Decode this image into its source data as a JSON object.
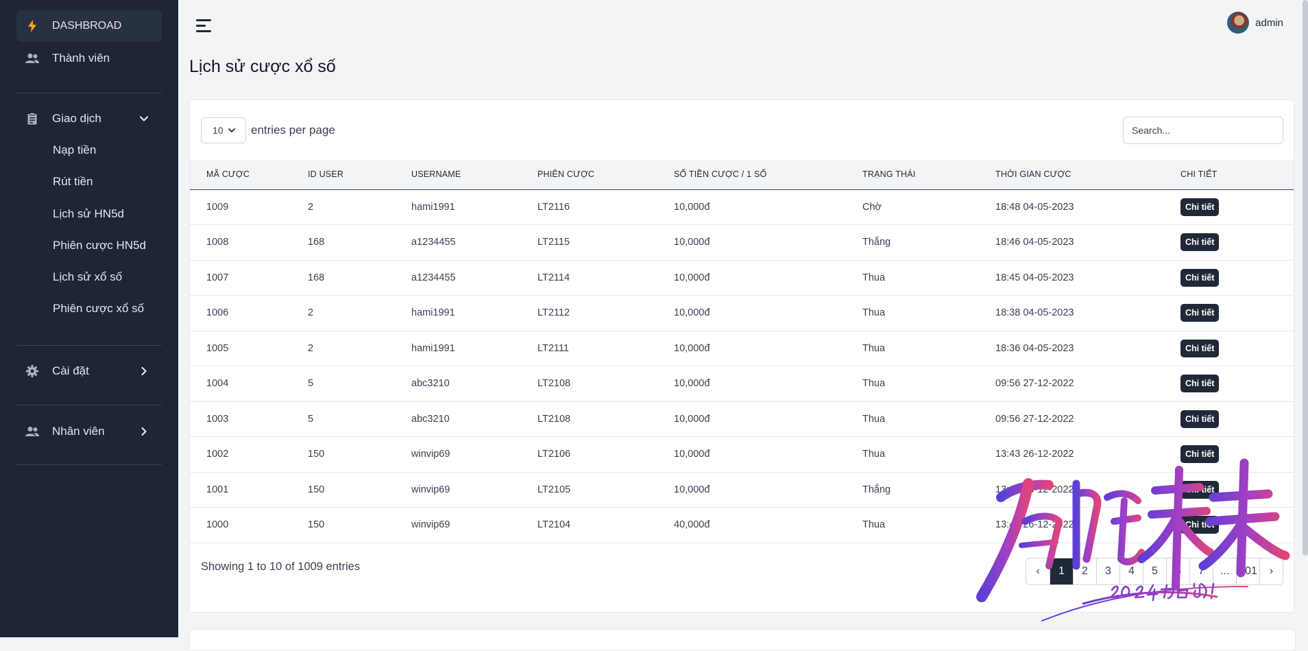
{
  "sidebar": {
    "dashboard": "DASHBROAD",
    "members": "Thành viên",
    "transactions": "Giao dịch",
    "sub_items": [
      "Nạp tiền",
      "Rút tiền",
      "Lịch sử HN5d",
      "Phiên cược HN5d",
      "Lịch sử xổ số",
      "Phiên cược xổ số"
    ],
    "settings": "Cài đặt",
    "staff": "Nhân viên"
  },
  "header": {
    "user_name": "admin"
  },
  "page": {
    "title": "Lịch sử cược xổ số"
  },
  "controls": {
    "per_page_value": "10",
    "per_page_label": "entries per page",
    "search_placeholder": "Search..."
  },
  "table": {
    "columns": [
      "MÃ CƯỢC",
      "ID USER",
      "USERNAME",
      "PHIÊN CƯỢC",
      "SỐ TIỀN CƯỢC / 1 SỐ",
      "TRẠNG THÁI",
      "THỜI GIAN CƯỢC",
      "CHI TIẾT"
    ],
    "detail_label": "Chi tiết",
    "rows": [
      {
        "id": "1009",
        "user_id": "2",
        "username": "hami1991",
        "session": "LT2116",
        "amount": "10,000đ",
        "status": "Chờ",
        "time": "18:48 04-05-2023"
      },
      {
        "id": "1008",
        "user_id": "168",
        "username": "a1234455",
        "session": "LT2115",
        "amount": "10,000đ",
        "status": "Thắng",
        "time": "18:46 04-05-2023"
      },
      {
        "id": "1007",
        "user_id": "168",
        "username": "a1234455",
        "session": "LT2114",
        "amount": "10,000đ",
        "status": "Thua",
        "time": "18:45 04-05-2023"
      },
      {
        "id": "1006",
        "user_id": "2",
        "username": "hami1991",
        "session": "LT2112",
        "amount": "10,000đ",
        "status": "Thua",
        "time": "18:38 04-05-2023"
      },
      {
        "id": "1005",
        "user_id": "2",
        "username": "hami1991",
        "session": "LT2111",
        "amount": "10,000đ",
        "status": "Thua",
        "time": "18:36 04-05-2023"
      },
      {
        "id": "1004",
        "user_id": "5",
        "username": "abc3210",
        "session": "LT2108",
        "amount": "10,000đ",
        "status": "Thua",
        "time": "09:56 27-12-2022"
      },
      {
        "id": "1003",
        "user_id": "5",
        "username": "abc3210",
        "session": "LT2108",
        "amount": "10,000đ",
        "status": "Thua",
        "time": "09:56 27-12-2022"
      },
      {
        "id": "1002",
        "user_id": "150",
        "username": "winvip69",
        "session": "LT2106",
        "amount": "10,000đ",
        "status": "Thua",
        "time": "13:43 26-12-2022"
      },
      {
        "id": "1001",
        "user_id": "150",
        "username": "winvip69",
        "session": "LT2105",
        "amount": "10,000đ",
        "status": "Thắng",
        "time": "13:41 26-12-2022"
      },
      {
        "id": "1000",
        "user_id": "150",
        "username": "winvip69",
        "session": "LT2104",
        "amount": "40,000đ",
        "status": "Thua",
        "time": "13:40 26-12-2022"
      }
    ]
  },
  "footer": {
    "showing": "Showing 1 to 10 of 1009 entries",
    "pages": [
      "‹",
      "1",
      "2",
      "3",
      "4",
      "5",
      "6",
      "7",
      "...",
      "101",
      "›"
    ],
    "current_page": "1"
  },
  "watermark": {
    "main": "启航未来",
    "sub": "2024加油!"
  },
  "colors": {
    "sidebar_bg": "#1e2535",
    "accent": "#1f2937",
    "dashboard_icon": "#f5a623"
  }
}
